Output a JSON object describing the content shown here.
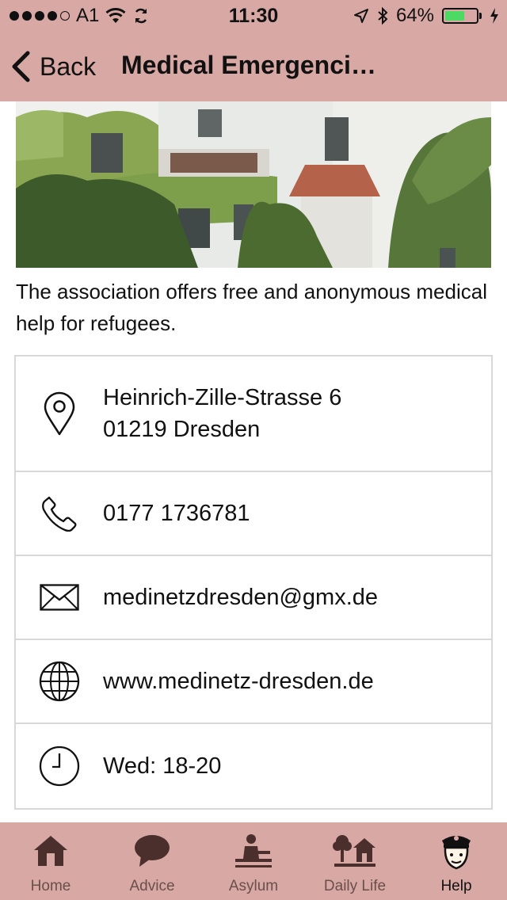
{
  "status_bar": {
    "carrier": "A1",
    "time": "11:30",
    "battery": "64%",
    "battery_level": 0.64
  },
  "nav": {
    "back_label": "Back",
    "title": "Medical Emergenci…"
  },
  "description": "The association offers free and anonymous medical help for refugees.",
  "contact": {
    "address_line1": "Heinrich-Zille-Strasse 6",
    "address_line2": "01219 Dresden",
    "phone": "0177 1736781",
    "email": "medinetzdresden@gmx.de",
    "website": "www.medinetz-dresden.de",
    "hours": "Wed: 18-20"
  },
  "icons": {
    "address": "map-pin-icon",
    "phone": "phone-icon",
    "email": "envelope-icon",
    "website": "globe-icon",
    "hours": "clock-icon"
  },
  "tabs": [
    {
      "label": "Home",
      "icon": "home-icon"
    },
    {
      "label": "Advice",
      "icon": "speech-bubble-icon"
    },
    {
      "label": "Asylum",
      "icon": "desk-person-icon"
    },
    {
      "label": "Daily Life",
      "icon": "tree-house-icon"
    },
    {
      "label": "Help",
      "icon": "police-officer-icon",
      "active": true
    }
  ],
  "colors": {
    "bar_background": "#d8a8a4",
    "tab_inactive": "#6a4f4d",
    "tab_icon": "#4a2f2d",
    "battery_fill": "#4cd964"
  }
}
